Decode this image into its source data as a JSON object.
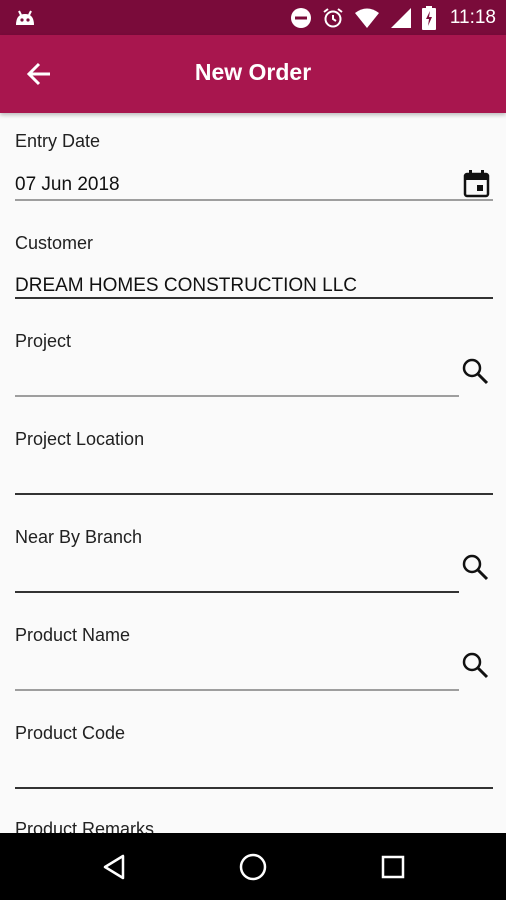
{
  "status_bar": {
    "time": "11:18",
    "icons": [
      "android-icon",
      "do-not-disturb-icon",
      "alarm-icon",
      "wifi-icon",
      "cell-signal-icon",
      "battery-charging-icon"
    ]
  },
  "toolbar": {
    "title": "New Order",
    "back_icon": "arrow-back-icon",
    "color": "#a8164e"
  },
  "form": {
    "entry_date": {
      "label": "Entry Date",
      "value": "07 Jun 2018",
      "icon": "calendar-icon"
    },
    "customer": {
      "label": "Customer",
      "value": "DREAM HOMES CONSTRUCTION LLC"
    },
    "project": {
      "label": "Project",
      "value": "",
      "icon": "search-icon"
    },
    "project_location": {
      "label": "Project Location",
      "value": ""
    },
    "near_by_branch": {
      "label": "Near By Branch",
      "value": "",
      "icon": "search-icon"
    },
    "product_name": {
      "label": "Product Name",
      "value": "",
      "icon": "search-icon"
    },
    "product_code": {
      "label": "Product Code",
      "value": ""
    },
    "product_remarks": {
      "label": "Product Remarks"
    }
  },
  "nav_bar": {
    "buttons": [
      "back-triangle-icon",
      "home-circle-icon",
      "recents-square-icon"
    ]
  }
}
